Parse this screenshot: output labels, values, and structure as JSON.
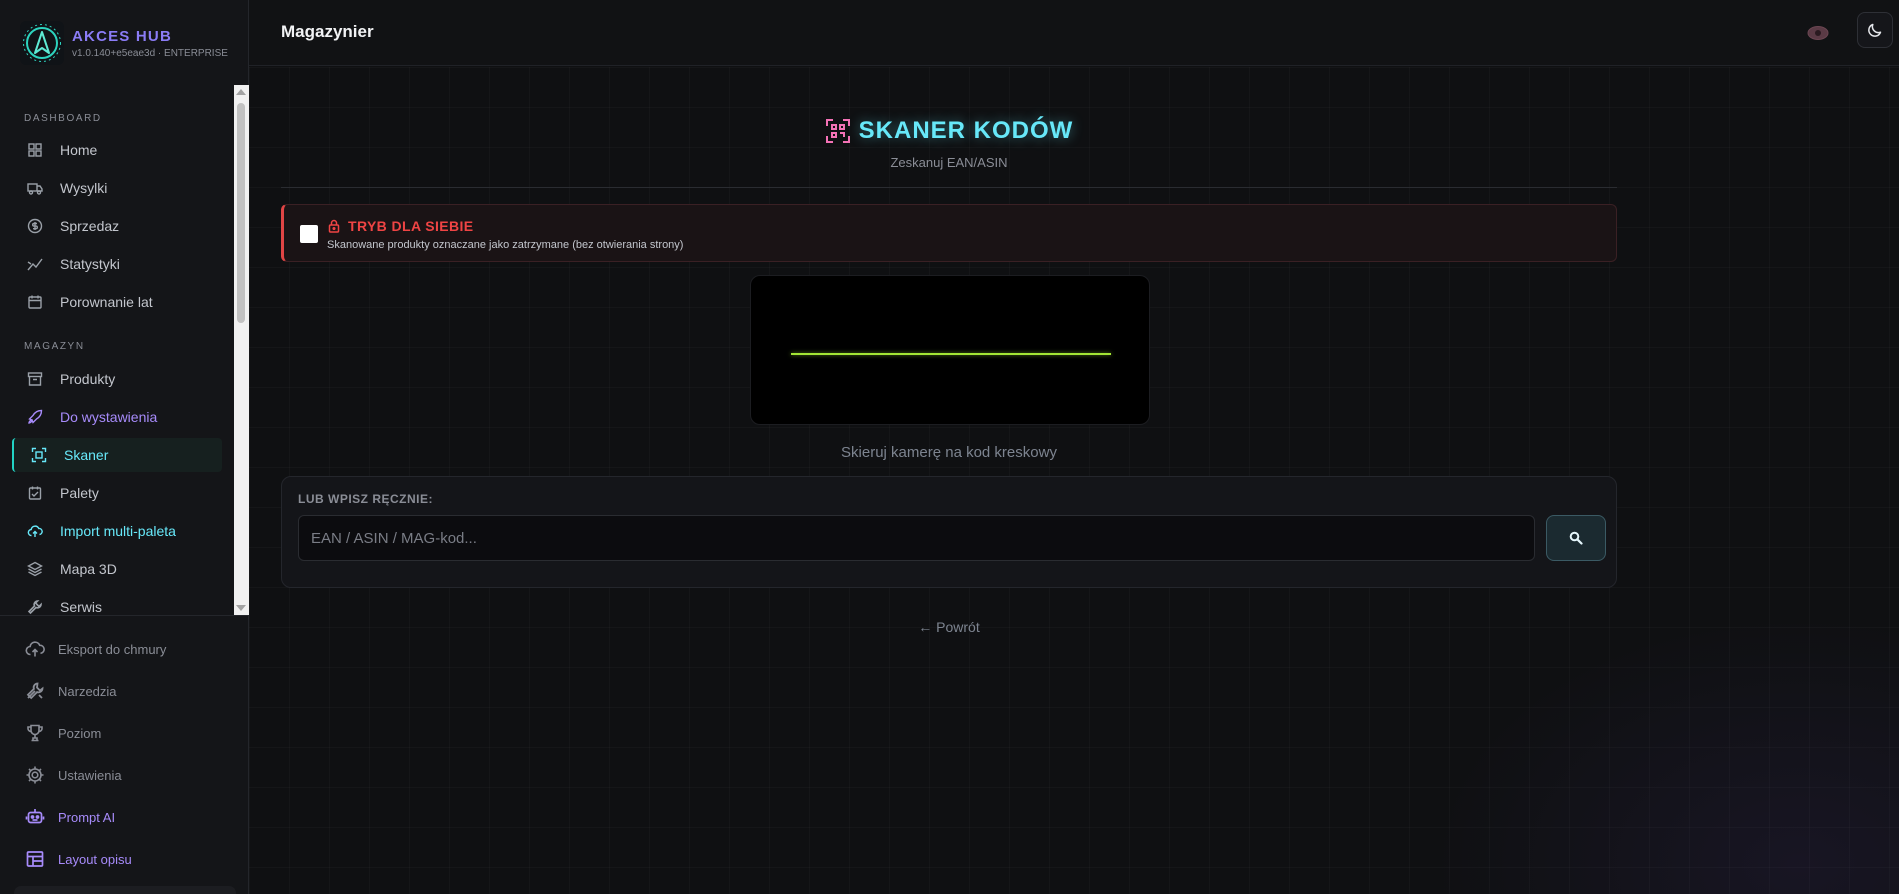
{
  "brand": {
    "title": "AKCES HUB",
    "version": "v1.0.140+e5eae3d · ENTERPRISE"
  },
  "sidebar": {
    "sections": [
      {
        "label": "DASHBOARD",
        "items": [
          {
            "label": "Home",
            "icon": "grid-icon"
          },
          {
            "label": "Wysylki",
            "icon": "truck-icon"
          },
          {
            "label": "Sprzedaz",
            "icon": "dollar-icon"
          },
          {
            "label": "Statystyki",
            "icon": "chart-line-icon"
          },
          {
            "label": "Porownanie lat",
            "icon": "calendar-icon"
          }
        ]
      },
      {
        "label": "MAGAZYN",
        "items": [
          {
            "label": "Produkty",
            "icon": "archive-icon"
          },
          {
            "label": "Do wystawienia",
            "icon": "rocket-icon"
          },
          {
            "label": "Skaner",
            "icon": "scan-icon",
            "active": true
          },
          {
            "label": "Palety",
            "icon": "pallet-icon"
          },
          {
            "label": "Import multi-paleta",
            "icon": "cloud-upload-icon"
          },
          {
            "label": "Mapa 3D",
            "icon": "layers-icon"
          },
          {
            "label": "Serwis",
            "icon": "wrench-icon"
          }
        ]
      }
    ],
    "bottom": [
      {
        "label": "Eksport do chmury",
        "icon": "cloud-upload-icon"
      },
      {
        "label": "Narzedzia",
        "icon": "tools-icon"
      },
      {
        "label": "Poziom",
        "icon": "trophy-icon"
      },
      {
        "label": "Ustawienia",
        "icon": "gear-icon"
      },
      {
        "label": "Prompt AI",
        "icon": "robot-icon"
      },
      {
        "label": "Layout opisu",
        "icon": "layout-icon"
      }
    ]
  },
  "topbar": {
    "title": "Magazynier"
  },
  "scanner": {
    "title": "SKANER KODÓW",
    "subtitle": "Zeskanuj EAN/ASIN",
    "mode_title": "TRYB DLA SIEBIE",
    "mode_desc": "Skanowane produkty oznaczane jako zatrzymane (bez otwierania strony)",
    "camera_hint": "Skieruj kamerę na kod kreskowy",
    "manual_label": "LUB WPISZ RĘCZNIE:",
    "manual_placeholder": "EAN / ASIN / MAG-kod...",
    "manual_value": "",
    "back_link": "← Powrót"
  },
  "colors": {
    "accent_cyan": "#67e8f9",
    "accent_purple": "#a78bfa",
    "danger": "#ef4444",
    "scan_line": "#a3e635"
  }
}
